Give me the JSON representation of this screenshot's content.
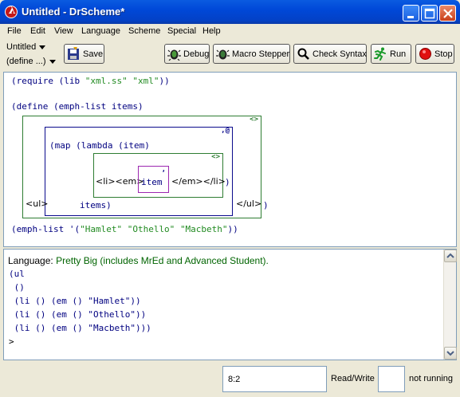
{
  "window": {
    "title": "Untitled - DrScheme*",
    "controls": [
      "minimize-icon",
      "maximize-icon",
      "close-icon"
    ]
  },
  "menu": [
    "File",
    "Edit",
    "View",
    "Language",
    "Scheme",
    "Special",
    "Help"
  ],
  "toolbar": {
    "file_name": "Untitled",
    "define_menu": "(define ...)",
    "save_label": "Save",
    "debug_label": "Debug",
    "macro_stepper_label": "Macro Stepper",
    "check_syntax_label": "Check Syntax",
    "run_label": "Run",
    "stop_label": "Stop"
  },
  "definitions": {
    "line1_open": "(require (lib ",
    "line1_s1": "\"xml.ss\"",
    "line1_s2": "\"xml\"",
    "line1_close": "))",
    "line2": "(define (emph-list items)",
    "xml_marker": "<>",
    "splice_marker": ",@",
    "map_line": "(map (lambda (item)",
    "li_open": "<li><em>",
    "unquote_marker": ",",
    "item": "item",
    "li_close": "</em></li>",
    "close_paren": ")",
    "ul_open": "<ul>",
    "items": "items)",
    "ul_close": "</ul>",
    "outer_close": ")",
    "line_call_open": "(emph-list '(",
    "s_hamlet": "\"Hamlet\"",
    "s_othello": "\"Othello\"",
    "s_macbeth": "\"Macbeth\"",
    "line_call_close": "))"
  },
  "interactions": {
    "language_prefix": "Language: ",
    "language_name": "Pretty Big (includes MrEd and Advanced Student).",
    "output": [
      "(ul",
      " ()",
      " (li () (em () \"Hamlet\"))",
      " (li () (em () \"Othello\"))",
      " (li () (em () \"Macbeth\")))"
    ],
    "prompt": ">"
  },
  "status": {
    "position": "8:2",
    "mode": "Read/Write",
    "running": "not running"
  },
  "colors": {
    "keyword": "#000080",
    "string": "#228b22",
    "language_name": "#006400",
    "xml_box": "#2e7d32",
    "splice_box": "#0a0a8c",
    "unquote_box": "#9c27b0"
  }
}
